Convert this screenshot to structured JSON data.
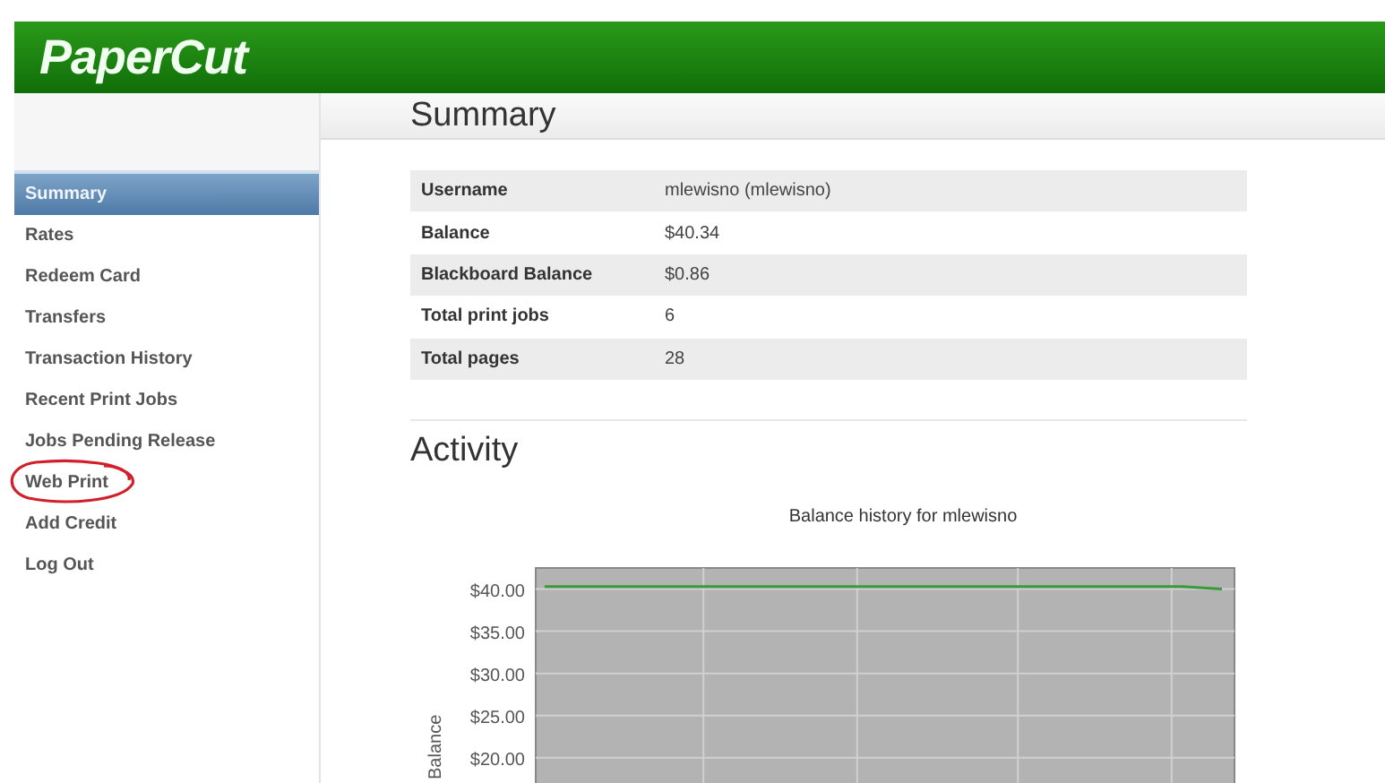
{
  "header": {
    "logo": "PaperCut"
  },
  "page_title": "Summary",
  "sidebar": {
    "items": [
      {
        "label": "Summary",
        "selected": true
      },
      {
        "label": "Rates",
        "selected": false
      },
      {
        "label": "Redeem Card",
        "selected": false
      },
      {
        "label": "Transfers",
        "selected": false
      },
      {
        "label": "Transaction History",
        "selected": false
      },
      {
        "label": "Recent Print Jobs",
        "selected": false
      },
      {
        "label": "Jobs Pending Release",
        "selected": false
      },
      {
        "label": "Web Print",
        "selected": false
      },
      {
        "label": "Add Credit",
        "selected": false
      },
      {
        "label": "Log Out",
        "selected": false
      }
    ]
  },
  "summary_table": {
    "rows": [
      {
        "label": "Username",
        "value": "mlewisno (mlewisno)"
      },
      {
        "label": "Balance",
        "value": "$40.34"
      },
      {
        "label": "Blackboard Balance",
        "value": "$0.86"
      },
      {
        "label": "Total print jobs",
        "value": "6"
      },
      {
        "label": "Total pages",
        "value": "28"
      }
    ]
  },
  "activity": {
    "heading": "Activity",
    "chart_data": {
      "type": "line",
      "title": "Balance history for mlewisno",
      "ylabel": "Balance",
      "ylim": [
        17,
        42.5
      ],
      "yticks": [
        {
          "value": 40,
          "label": "$40.00"
        },
        {
          "value": 35,
          "label": "$35.00"
        },
        {
          "value": 30,
          "label": "$30.00"
        },
        {
          "value": 25,
          "label": "$25.00"
        },
        {
          "value": 20,
          "label": "$20.00"
        }
      ],
      "grid": true,
      "series": [
        {
          "color": "#3a9a3a",
          "values": [
            40.3,
            40.3,
            40.3,
            40.3,
            40.3,
            40.3,
            40.3,
            40.3,
            40.3,
            40.3,
            40.3,
            40.3,
            40.3,
            40.3,
            40.3,
            40.3,
            40.3,
            40.0
          ]
        }
      ]
    }
  }
}
